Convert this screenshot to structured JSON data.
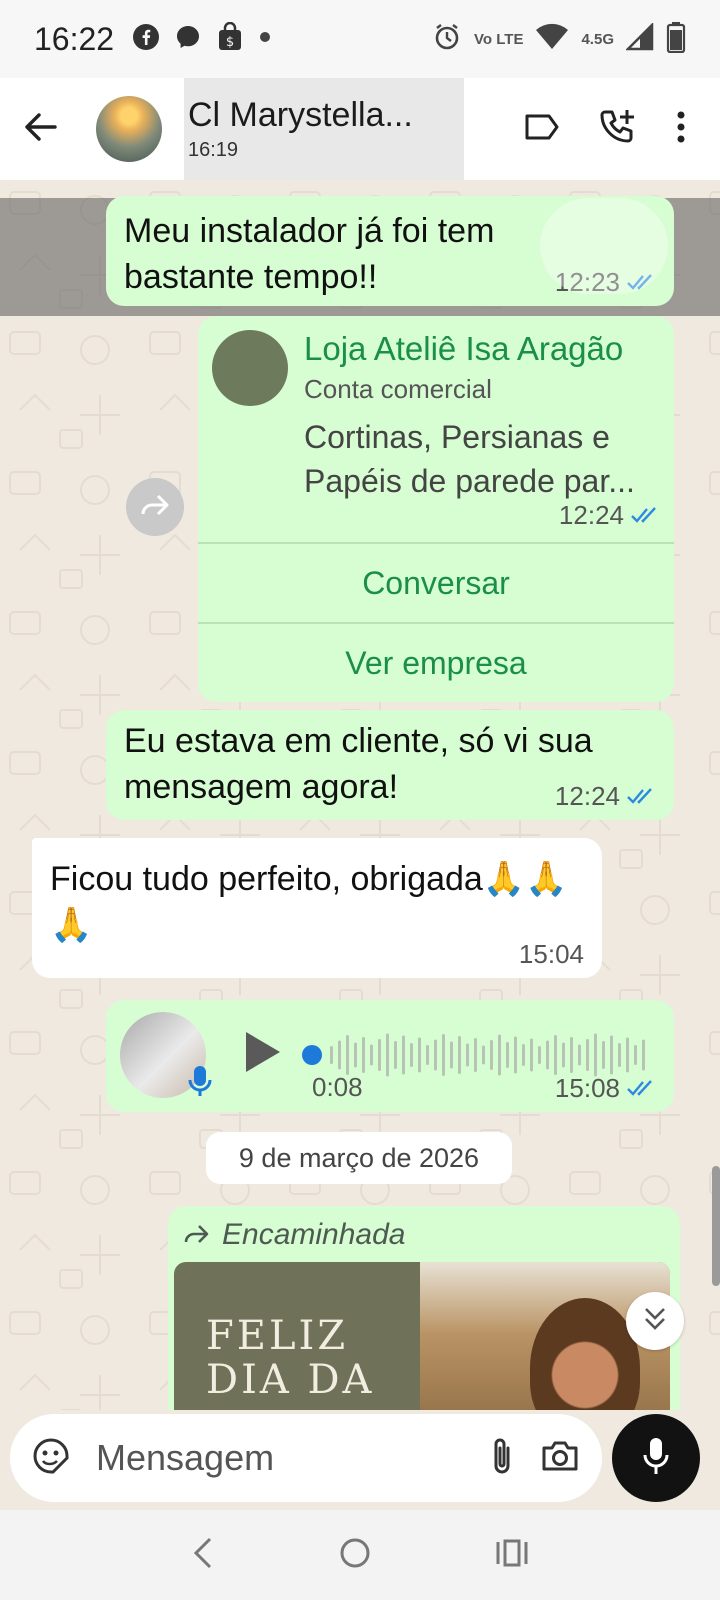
{
  "status_bar": {
    "time": "16:22",
    "left_icons": [
      "facebook-icon",
      "messenger-icon",
      "shopping-bag-icon",
      "dot-icon"
    ],
    "network_volte": "Vo LTE",
    "network_type": "4.5G",
    "right_icons": [
      "alarm-icon",
      "volte-icon",
      "wifi-icon",
      "signal-icon",
      "battery-icon"
    ]
  },
  "header": {
    "title": "Cl Marystella...",
    "subtitle": "16:19",
    "icons": [
      "back-arrow-icon",
      "label-icon",
      "add-call-icon",
      "more-vert-icon"
    ]
  },
  "messages": [
    {
      "type": "text",
      "direction": "out",
      "text": "Meu instalador já foi tem bastante tempo!!",
      "time": "12:23",
      "status": "read"
    },
    {
      "type": "business_card",
      "direction": "out",
      "name": "Loja Ateliê Isa Aragão",
      "account_type": "Conta comercial",
      "description": "Cortinas, Persianas e Papéis de parede par...",
      "time": "12:24",
      "status": "read",
      "actions": [
        "Conversar",
        "Ver empresa"
      ]
    },
    {
      "type": "text",
      "direction": "out",
      "text": "Eu  estava em cliente, só vi sua mensagem agora!",
      "time": "12:24",
      "status": "read"
    },
    {
      "type": "text",
      "direction": "in",
      "text": "Ficou tudo perfeito, obrigada🙏🙏🙏",
      "time": "15:04"
    },
    {
      "type": "voice",
      "direction": "out",
      "duration": "0:08",
      "time": "15:08",
      "status": "read",
      "progress": 0.0
    }
  ],
  "date_separator": "9 de março de 2026",
  "forwarded": {
    "label": "Encaminhada",
    "image_text": "FELIZ DIA DA"
  },
  "composer": {
    "placeholder": "Mensagem",
    "icons": [
      "sticker-icon",
      "attach-icon",
      "camera-icon",
      "mic-icon"
    ]
  },
  "nav_bar": {
    "icons": [
      "nav-back-icon",
      "nav-home-icon",
      "nav-recents-icon"
    ]
  },
  "colors": {
    "outgoing_bubble": "#d7fdd2",
    "incoming_bubble": "#ffffff",
    "accent_green": "#1a8f4a",
    "read_tick_blue": "#2a8be0",
    "chat_background": "#efe9df"
  }
}
